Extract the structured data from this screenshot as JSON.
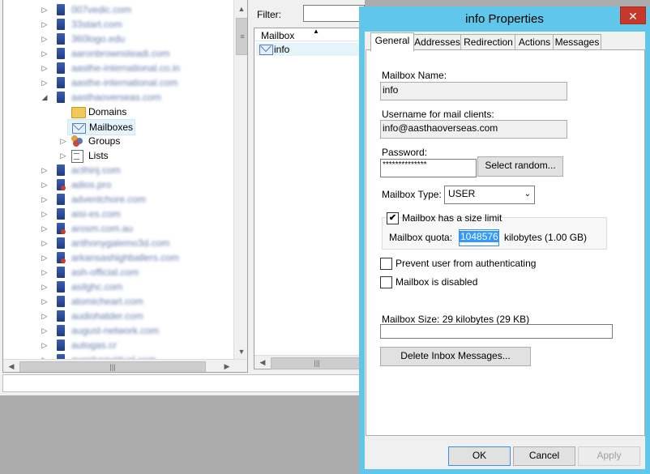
{
  "dialog": {
    "title": "info Properties",
    "tabs": [
      "General",
      "Addresses",
      "Redirection",
      "Actions",
      "Messages"
    ],
    "mailbox_name_label": "Mailbox Name:",
    "mailbox_name_value": "info",
    "username_label": "Username for mail clients:",
    "username_value": "info@aasthaoverseas.com",
    "password_label": "Password:",
    "password_value": "**************",
    "select_random_label": "Select random...",
    "mailbox_type_label": "Mailbox Type:",
    "mailbox_type_value": "USER",
    "size_limit_label": "Mailbox has a size limit",
    "size_limit_checked": "✔",
    "quota_label": "Mailbox quota:",
    "quota_value": "1048576",
    "quota_unit": "kilobytes (1.00 GB)",
    "prevent_auth_label": "Prevent user from authenticating",
    "disabled_label": "Mailbox is disabled",
    "mailbox_size_label": "Mailbox Size:  29 kilobytes (29 KB)",
    "delete_inbox_label": "Delete Inbox Messages...",
    "ok_label": "OK",
    "cancel_label": "Cancel",
    "apply_label": "Apply",
    "close_glyph": "✕"
  },
  "list": {
    "filter_label": "Filter:",
    "column_header": "Mailbox",
    "sort_glyph": "▲",
    "items": [
      "info"
    ]
  },
  "tree": {
    "domains_label": "Domains",
    "mailboxes_label": "Mailboxes",
    "groups_label": "Groups",
    "lists_label": "Lists",
    "blurred_domains": [
      "007vedic.com",
      "33start.com",
      "360logo.edu",
      "aaronbrownsteadi.com",
      "aasthe-international.co.in",
      "aasthe-international.com",
      "aasthaoverseas.com",
      "acthinj.com",
      "adios.pro",
      "adventchore.com",
      "aisi-es.com",
      "arosm.com.au",
      "anthonygalemo3d.com",
      "arkansashighballers.com",
      "ash-official.com",
      "asilghc.com",
      "atomicheart.com",
      "audiohatder.com",
      "august-network.com",
      "autogas.cr",
      "aventuravirtual.com"
    ]
  },
  "icons": {
    "expand": "▷",
    "collapse": "◢",
    "scroll_up": "▲",
    "scroll_down": "▼",
    "scroll_left": "◀",
    "scroll_right": "▶",
    "grip": "≡",
    "hgrip": "|||"
  }
}
